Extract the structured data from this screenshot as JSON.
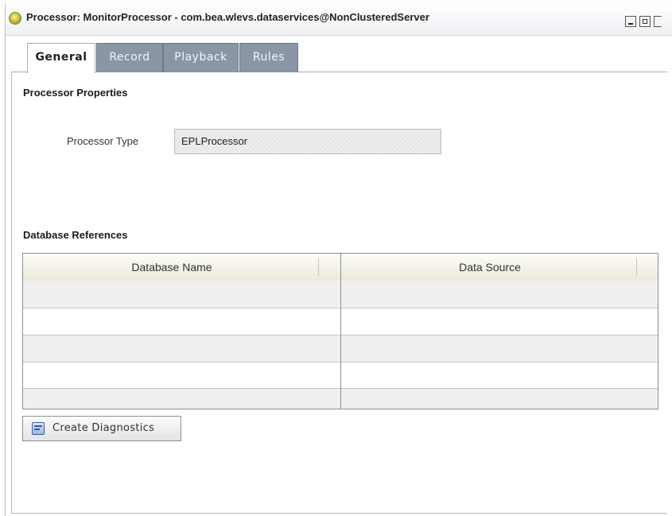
{
  "window": {
    "title": "Processor: MonitorProcessor - com.bea.wlevs.dataservices@NonClusteredServer",
    "icon": "processor-gear-icon",
    "controls": [
      "minimize-icon",
      "maximize-icon",
      "close-icon"
    ]
  },
  "tabs": [
    {
      "label": "General",
      "active": true
    },
    {
      "label": "Record",
      "active": false
    },
    {
      "label": "Playback",
      "active": false
    },
    {
      "label": "Rules",
      "active": false
    }
  ],
  "processor_properties": {
    "heading": "Processor Properties",
    "type_label": "Processor Type",
    "type_value": "EPLProcessor"
  },
  "database_references": {
    "heading": "Database References",
    "columns": [
      "Database Name",
      "Data Source"
    ],
    "rows": [
      [
        "",
        ""
      ],
      [
        "",
        ""
      ],
      [
        "",
        ""
      ],
      [
        "",
        ""
      ],
      [
        "",
        ""
      ]
    ]
  },
  "actions": {
    "create_diagnostics_label": "Create Diagnostics",
    "create_diagnostics_icon": "diagnostics-icon"
  },
  "colors": {
    "tab_inactive": "#8a96a6",
    "table_header": "#ece9d8",
    "row_alt": "#efefef"
  }
}
